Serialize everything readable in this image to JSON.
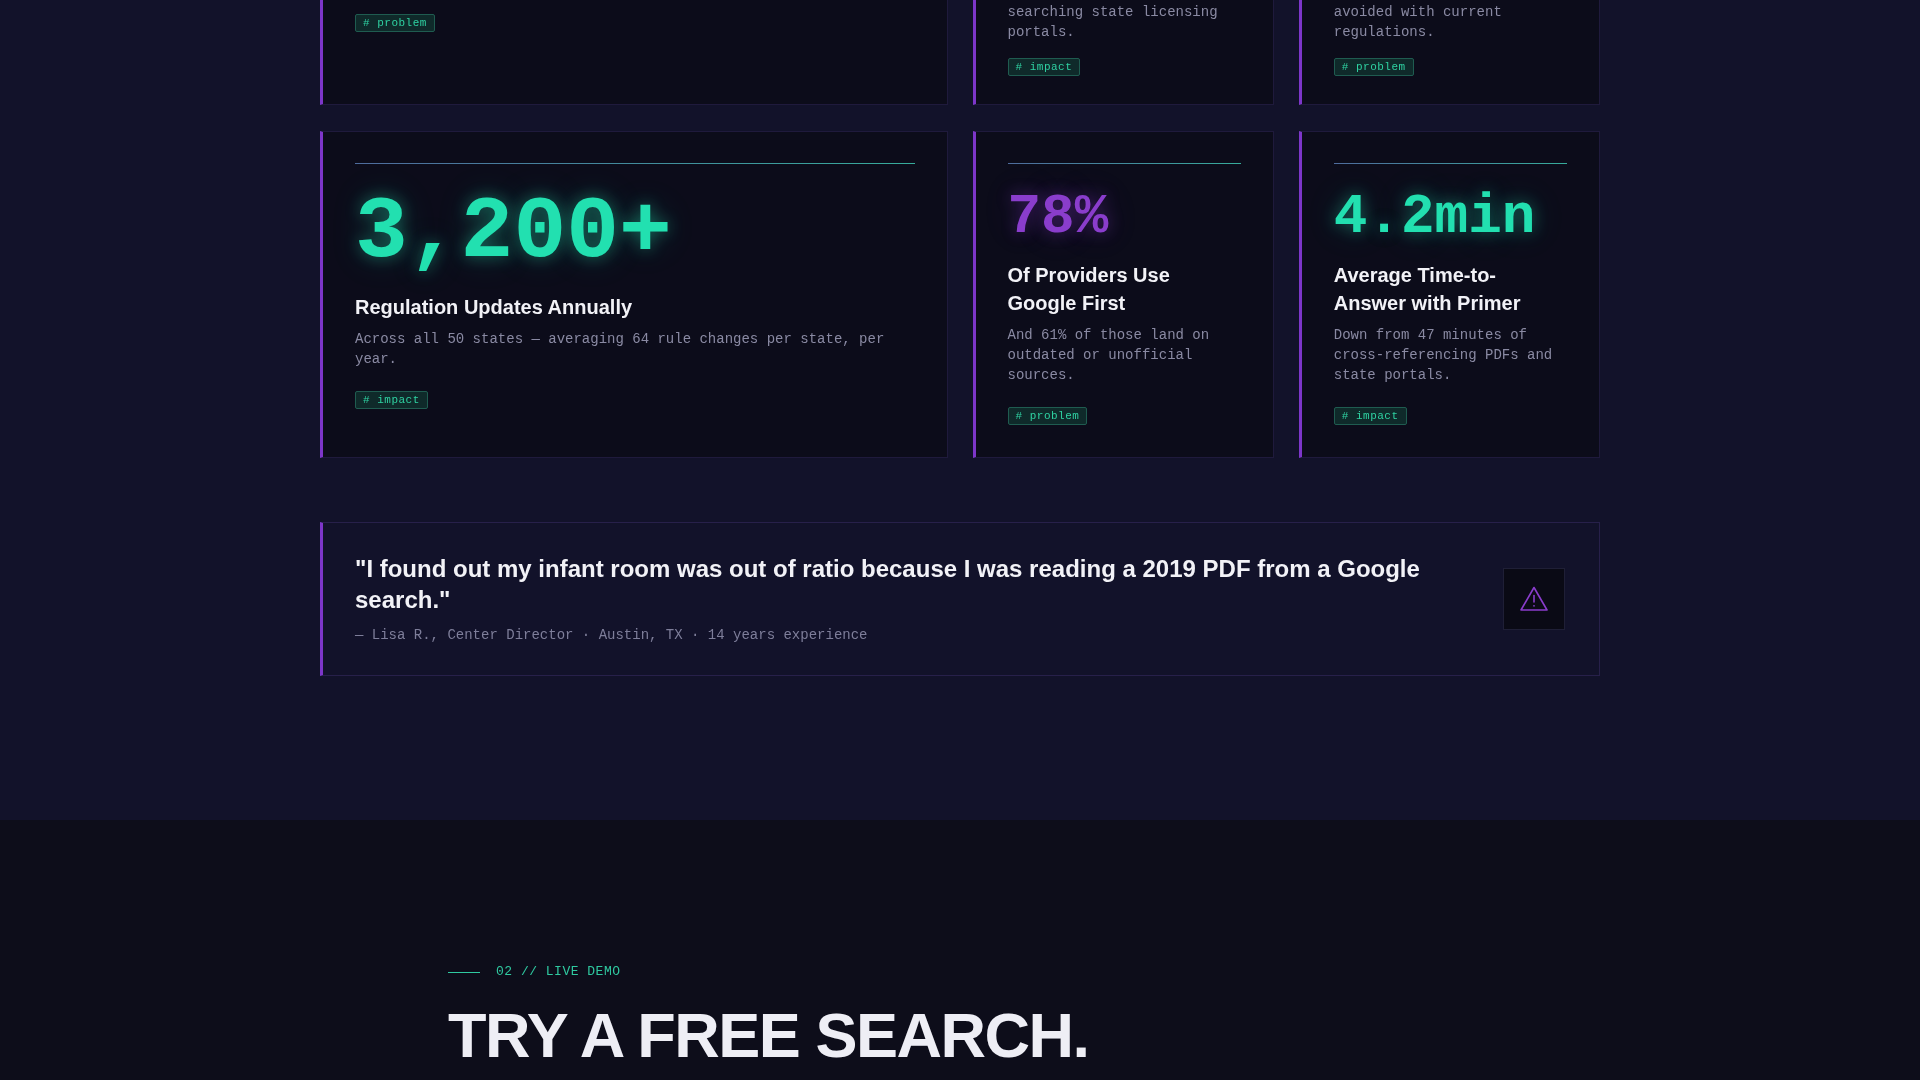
{
  "upper_cards": [
    {
      "tag": "# problem"
    },
    {
      "description": "searching state licensing portals.",
      "tag": "# impact"
    },
    {
      "description": "avoided with current regulations.",
      "tag": "# problem"
    }
  ],
  "stat_cards": [
    {
      "value": "3,200+",
      "color": "#22e0b0",
      "title": "Regulation Updates Annually",
      "description": "Across all 50 states — averaging 64 rule changes per state, per year.",
      "tag": "# impact"
    },
    {
      "value": "78%",
      "color": "#8a3dcc",
      "title": "Of Providers Use Google First",
      "description": "And 61% of those land on outdated or unofficial sources.",
      "tag": "# problem"
    },
    {
      "value": "4.2min",
      "color": "#22e0b0",
      "title": "Average Time-to-Answer with Primer",
      "description": "Down from 47 minutes of cross-referencing PDFs and state portals.",
      "tag": "# impact"
    }
  ],
  "quote": {
    "text": "\"I found out my infant room was out of ratio because I was reading a 2019 PDF from a Google search.\"",
    "attribution": "— Lisa R., Center Director · Austin, TX · 14 years experience"
  },
  "demo": {
    "eyebrow": "02 // LIVE DEMO",
    "heading": "TRY A FREE SEARCH."
  }
}
